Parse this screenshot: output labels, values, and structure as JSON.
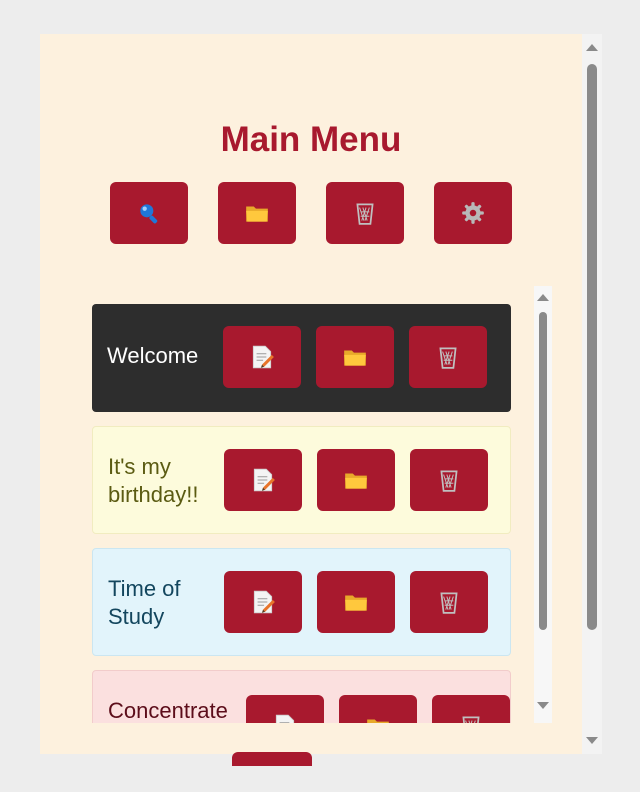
{
  "header": {
    "title": "Main Menu"
  },
  "toolbar": {
    "buttons": [
      {
        "name": "search-button",
        "icon": "search-icon"
      },
      {
        "name": "folder-button",
        "icon": "folder-icon"
      },
      {
        "name": "trash-button",
        "icon": "trash-icon"
      },
      {
        "name": "settings-button",
        "icon": "gear-icon"
      }
    ]
  },
  "entries": [
    {
      "label": "Welcome",
      "background": "#2d2d2d",
      "text_color": "#ffffff"
    },
    {
      "label": "It's my birthday!!",
      "background": "#fdfbdc",
      "text_color": "#5b5b12"
    },
    {
      "label": "Time of Study",
      "background": "#e2f4fb",
      "text_color": "#13465e"
    },
    {
      "label": "Concentrate",
      "background": "#fbe0df",
      "text_color": "#5c0d1a"
    }
  ],
  "entry_actions": [
    "edit-icon",
    "folder-icon",
    "trash-icon"
  ],
  "colors": {
    "accent": "#a8192e",
    "page_background": "#fdf1de",
    "folder": "#ffc83d",
    "search": "#1f77d8"
  }
}
